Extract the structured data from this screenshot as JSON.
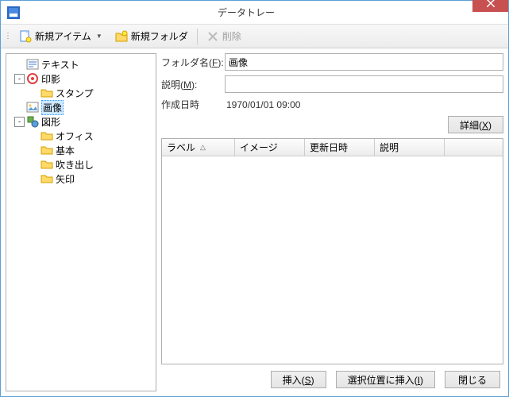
{
  "window": {
    "title": "データトレー"
  },
  "toolbar": {
    "new_item": "新規アイテム",
    "new_folder": "新規フォルダ",
    "delete": "削除"
  },
  "tree": {
    "items": [
      {
        "label": "テキスト",
        "depth": 1,
        "icon": "text",
        "exp": null
      },
      {
        "label": "印影",
        "depth": 1,
        "icon": "stamp",
        "exp": "-"
      },
      {
        "label": "スタンプ",
        "depth": 2,
        "icon": "folder",
        "exp": null
      },
      {
        "label": "画像",
        "depth": 1,
        "icon": "image",
        "exp": null,
        "selected": true
      },
      {
        "label": "図形",
        "depth": 1,
        "icon": "shape",
        "exp": "-"
      },
      {
        "label": "オフィス",
        "depth": 2,
        "icon": "folder",
        "exp": null
      },
      {
        "label": "基本",
        "depth": 2,
        "icon": "folder",
        "exp": null
      },
      {
        "label": "吹き出し",
        "depth": 2,
        "icon": "folder",
        "exp": null
      },
      {
        "label": "矢印",
        "depth": 2,
        "icon": "folder",
        "exp": null
      }
    ]
  },
  "form": {
    "folder_label_pre": "フォルダ名(",
    "folder_label_key": "F",
    "folder_label_post": "):",
    "folder_value": "画像",
    "desc_label_pre": "説明(",
    "desc_label_key": "M",
    "desc_label_post": "):",
    "desc_value": "",
    "date_label": "作成日時",
    "date_value": "1970/01/01 09:00",
    "detail_btn_pre": "詳細(",
    "detail_btn_key": "X",
    "detail_btn_post": ")"
  },
  "grid": {
    "cols": [
      "ラベル",
      "イメージ",
      "更新日時",
      "説明"
    ]
  },
  "buttons": {
    "insert_pre": "挿入(",
    "insert_key": "S",
    "insert_post": ")",
    "insert_at_pre": "選択位置に挿入(",
    "insert_at_key": "I",
    "insert_at_post": ")",
    "close": "閉じる"
  }
}
